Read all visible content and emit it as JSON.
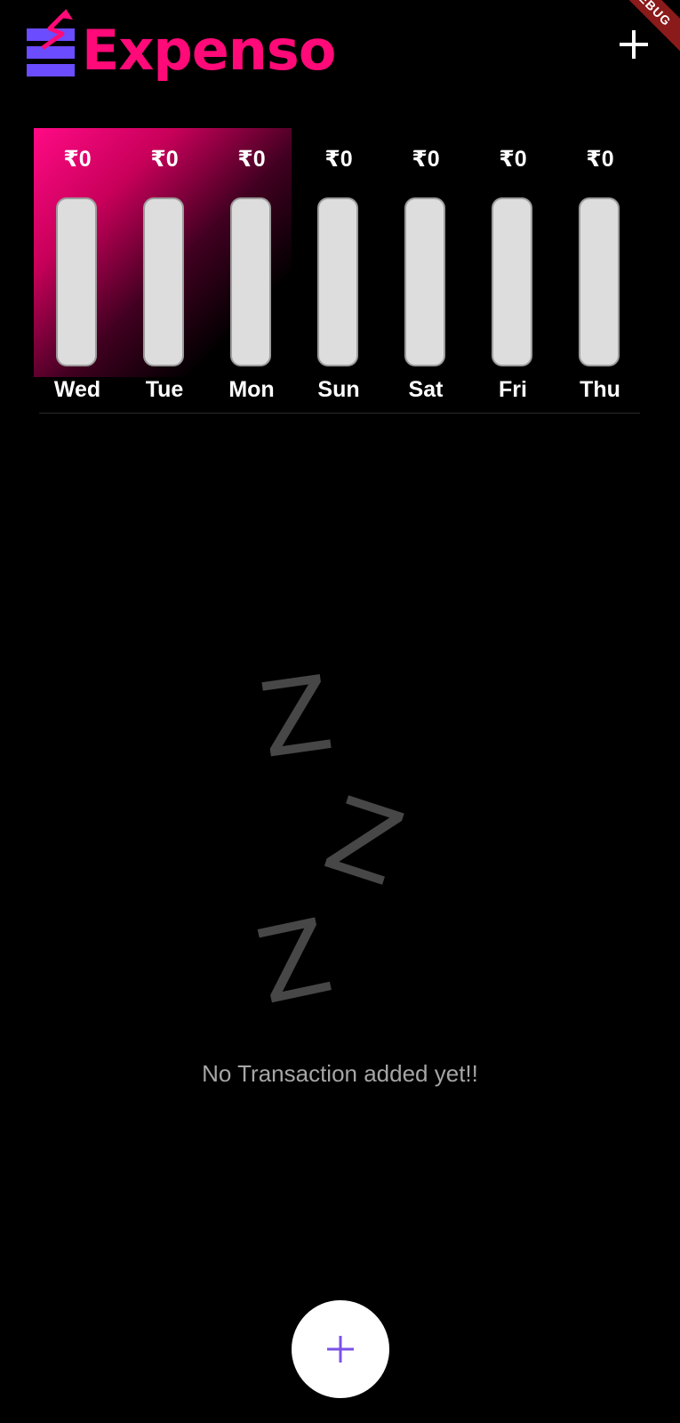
{
  "app": {
    "title": "Expenso",
    "debug_banner": "DEBUG"
  },
  "colors": {
    "brand": "#ff0a78",
    "logo_mark": "#6b4cff",
    "bar_empty": "#dddddd",
    "fab_icon": "#7a52e6"
  },
  "icons": {
    "add_top": "plus-icon",
    "fab": "plus-icon",
    "empty_state": "sleep-zzz-icon"
  },
  "chart": {
    "days": [
      {
        "label": "Wed",
        "amount": "₹0",
        "fill_fraction": 0
      },
      {
        "label": "Tue",
        "amount": "₹0",
        "fill_fraction": 0
      },
      {
        "label": "Mon",
        "amount": "₹0",
        "fill_fraction": 0
      },
      {
        "label": "Sun",
        "amount": "₹0",
        "fill_fraction": 0
      },
      {
        "label": "Sat",
        "amount": "₹0",
        "fill_fraction": 0
      },
      {
        "label": "Fri",
        "amount": "₹0",
        "fill_fraction": 0
      },
      {
        "label": "Thu",
        "amount": "₹0",
        "fill_fraction": 0
      }
    ]
  },
  "empty_state": {
    "art_letters": [
      "Z",
      "Z",
      "Z"
    ],
    "message": "No Transaction added yet!!"
  }
}
